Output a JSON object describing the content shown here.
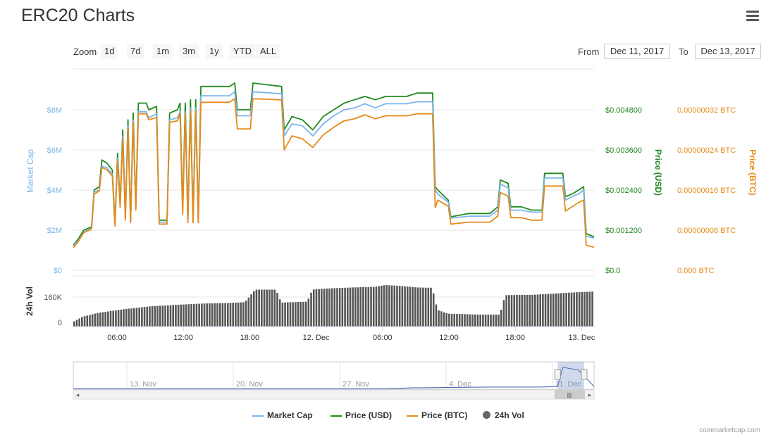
{
  "header": {
    "title": "ERC20 Charts",
    "menu_icon": "hamburger-menu-icon"
  },
  "toolbar": {
    "zoom_label": "Zoom",
    "zoom_buttons": [
      "1d",
      "7d",
      "1m",
      "3m",
      "1y",
      "YTD",
      "ALL"
    ],
    "from_label": "From",
    "from_value": "Dec 11, 2017",
    "to_label": "To",
    "to_value": "Dec 13, 2017"
  },
  "colors": {
    "market_cap": "#7cb5ec",
    "price_usd": "#1e8a1e",
    "price_btc": "#e68a1a",
    "volume": "#555555",
    "grid": "#e6e6e6"
  },
  "legend": [
    {
      "label": "Market Cap"
    },
    {
      "label": "Price (USD)"
    },
    {
      "label": "Price (BTC)"
    },
    {
      "label": "24h Vol"
    }
  ],
  "credit": "coinmarketcap.com",
  "chart_data": {
    "type": "line",
    "title": "ERC20 Charts",
    "x_range": [
      "Dec 11, 2017 02:00",
      "Dec 13, 2017 00:00"
    ],
    "x_ticks": [
      "06:00",
      "12:00",
      "18:00",
      "12. Dec",
      "06:00",
      "12:00",
      "18:00",
      "13. Dec"
    ],
    "y_axes": {
      "market_cap": {
        "label": "Market Cap",
        "ticks": [
          "$0",
          "$2M",
          "$4M",
          "$6M",
          "$8M"
        ],
        "range": [
          0,
          8000000
        ]
      },
      "price_usd": {
        "label": "Price (USD)",
        "ticks": [
          "$0.0",
          "$0.001200",
          "$0.002400",
          "$0.003600",
          "$0.004800"
        ],
        "range": [
          0,
          0.0048
        ]
      },
      "price_btc": {
        "label": "Price (BTC)",
        "ticks": [
          "0.000 BTC",
          "0.00000008 BTC",
          "0.00000016 BTC",
          "0.00000024 BTC",
          "0.00000032 BTC"
        ],
        "range": [
          0,
          3.2e-07
        ]
      },
      "volume": {
        "label": "24h Vol",
        "ticks": [
          "0",
          "160K"
        ],
        "range": [
          0,
          160000
        ]
      }
    },
    "grid": true,
    "legend_position": "bottom-center",
    "series": [
      {
        "name": "Price (USD)",
        "axis": "price_usd",
        "points": [
          [
            0.0,
            0.00075
          ],
          [
            0.01,
            0.00095
          ],
          [
            0.02,
            0.0012
          ],
          [
            0.035,
            0.0013
          ],
          [
            0.04,
            0.0024
          ],
          [
            0.05,
            0.0025
          ],
          [
            0.055,
            0.0033
          ],
          [
            0.065,
            0.0032
          ],
          [
            0.075,
            0.003
          ],
          [
            0.08,
            0.0014
          ],
          [
            0.085,
            0.0035
          ],
          [
            0.09,
            0.002
          ],
          [
            0.095,
            0.0042
          ],
          [
            0.1,
            0.0016
          ],
          [
            0.105,
            0.0045
          ],
          [
            0.11,
            0.0015
          ],
          [
            0.115,
            0.0047
          ],
          [
            0.12,
            0.0019
          ],
          [
            0.125,
            0.005
          ],
          [
            0.14,
            0.005
          ],
          [
            0.145,
            0.0048
          ],
          [
            0.16,
            0.0049
          ],
          [
            0.165,
            0.0015
          ],
          [
            0.18,
            0.0015
          ],
          [
            0.185,
            0.0047
          ],
          [
            0.2,
            0.0048
          ],
          [
            0.205,
            0.005
          ],
          [
            0.21,
            0.0018
          ],
          [
            0.215,
            0.005
          ],
          [
            0.22,
            0.0015
          ],
          [
            0.225,
            0.0051
          ],
          [
            0.23,
            0.0015
          ],
          [
            0.235,
            0.0051
          ],
          [
            0.24,
            0.0015
          ],
          [
            0.245,
            0.0055
          ],
          [
            0.3,
            0.0055
          ],
          [
            0.31,
            0.0056
          ],
          [
            0.315,
            0.0048
          ],
          [
            0.34,
            0.0048
          ],
          [
            0.345,
            0.0056
          ],
          [
            0.4,
            0.0055
          ],
          [
            0.405,
            0.0042
          ],
          [
            0.42,
            0.0046
          ],
          [
            0.44,
            0.0045
          ],
          [
            0.46,
            0.0042
          ],
          [
            0.48,
            0.0046
          ],
          [
            0.5,
            0.0048
          ],
          [
            0.52,
            0.005
          ],
          [
            0.54,
            0.0051
          ],
          [
            0.56,
            0.0052
          ],
          [
            0.58,
            0.0051
          ],
          [
            0.6,
            0.0052
          ],
          [
            0.62,
            0.0052
          ],
          [
            0.64,
            0.0052
          ],
          [
            0.66,
            0.0053
          ],
          [
            0.68,
            0.0053
          ],
          [
            0.69,
            0.0053
          ],
          [
            0.695,
            0.0025
          ],
          [
            0.7,
            0.0024
          ],
          [
            0.72,
            0.0021
          ],
          [
            0.725,
            0.0016
          ],
          [
            0.76,
            0.0017
          ],
          [
            0.8,
            0.0017
          ],
          [
            0.815,
            0.0019
          ],
          [
            0.82,
            0.0027
          ],
          [
            0.835,
            0.0026
          ],
          [
            0.84,
            0.0019
          ],
          [
            0.86,
            0.0019
          ],
          [
            0.88,
            0.0018
          ],
          [
            0.9,
            0.0018
          ],
          [
            0.905,
            0.0029
          ],
          [
            0.94,
            0.0029
          ],
          [
            0.945,
            0.0022
          ],
          [
            0.96,
            0.0023
          ],
          [
            0.97,
            0.0024
          ],
          [
            0.98,
            0.0025
          ],
          [
            0.985,
            0.0011
          ],
          [
            1.0,
            0.001
          ]
        ]
      },
      {
        "name": "Market Cap",
        "axis": "market_cap",
        "points": [
          [
            0.0,
            1200000
          ],
          [
            0.01,
            1500000
          ],
          [
            0.02,
            1900000
          ],
          [
            0.035,
            2100000
          ],
          [
            0.04,
            3900000
          ],
          [
            0.05,
            4000000
          ],
          [
            0.055,
            5200000
          ],
          [
            0.065,
            5100000
          ],
          [
            0.075,
            4800000
          ],
          [
            0.08,
            2300000
          ],
          [
            0.085,
            5600000
          ],
          [
            0.09,
            3200000
          ],
          [
            0.095,
            6700000
          ],
          [
            0.1,
            2600000
          ],
          [
            0.105,
            7200000
          ],
          [
            0.11,
            2400000
          ],
          [
            0.115,
            7500000
          ],
          [
            0.12,
            3100000
          ],
          [
            0.125,
            7900000
          ],
          [
            0.14,
            7900000
          ],
          [
            0.145,
            7600000
          ],
          [
            0.16,
            7800000
          ],
          [
            0.165,
            2400000
          ],
          [
            0.18,
            2400000
          ],
          [
            0.185,
            7500000
          ],
          [
            0.2,
            7600000
          ],
          [
            0.205,
            7900000
          ],
          [
            0.21,
            2900000
          ],
          [
            0.215,
            7900000
          ],
          [
            0.22,
            2400000
          ],
          [
            0.225,
            8100000
          ],
          [
            0.23,
            2400000
          ],
          [
            0.235,
            8100000
          ],
          [
            0.24,
            2400000
          ],
          [
            0.245,
            8700000
          ],
          [
            0.3,
            8700000
          ],
          [
            0.31,
            8900000
          ],
          [
            0.315,
            7700000
          ],
          [
            0.34,
            7700000
          ],
          [
            0.345,
            8900000
          ],
          [
            0.4,
            8800000
          ],
          [
            0.405,
            6700000
          ],
          [
            0.42,
            7300000
          ],
          [
            0.44,
            7200000
          ],
          [
            0.46,
            6700000
          ],
          [
            0.48,
            7300000
          ],
          [
            0.5,
            7700000
          ],
          [
            0.52,
            8000000
          ],
          [
            0.54,
            8100000
          ],
          [
            0.56,
            8300000
          ],
          [
            0.58,
            8100000
          ],
          [
            0.6,
            8300000
          ],
          [
            0.62,
            8300000
          ],
          [
            0.64,
            8300000
          ],
          [
            0.66,
            8400000
          ],
          [
            0.68,
            8400000
          ],
          [
            0.69,
            8400000
          ],
          [
            0.695,
            4000000
          ],
          [
            0.7,
            3800000
          ],
          [
            0.72,
            3400000
          ],
          [
            0.725,
            2600000
          ],
          [
            0.76,
            2700000
          ],
          [
            0.8,
            2700000
          ],
          [
            0.815,
            3000000
          ],
          [
            0.82,
            4300000
          ],
          [
            0.835,
            4100000
          ],
          [
            0.84,
            3000000
          ],
          [
            0.86,
            3000000
          ],
          [
            0.88,
            2900000
          ],
          [
            0.9,
            2900000
          ],
          [
            0.905,
            4600000
          ],
          [
            0.94,
            4600000
          ],
          [
            0.945,
            3500000
          ],
          [
            0.96,
            3700000
          ],
          [
            0.97,
            3800000
          ],
          [
            0.98,
            4000000
          ],
          [
            0.985,
            1700000
          ],
          [
            1.0,
            1600000
          ]
        ]
      },
      {
        "name": "Price (BTC)",
        "axis": "price_btc",
        "points": [
          [
            0.0,
            4.5e-08
          ],
          [
            0.01,
            5.8e-08
          ],
          [
            0.02,
            7.5e-08
          ],
          [
            0.035,
            8.2e-08
          ],
          [
            0.04,
            1.52e-07
          ],
          [
            0.05,
            1.58e-07
          ],
          [
            0.055,
            2.05e-07
          ],
          [
            0.065,
            2e-07
          ],
          [
            0.075,
            1.88e-07
          ],
          [
            0.08,
            8.8e-08
          ],
          [
            0.085,
            2.2e-07
          ],
          [
            0.09,
            1.25e-07
          ],
          [
            0.095,
            2.62e-07
          ],
          [
            0.1,
            1e-07
          ],
          [
            0.105,
            2.82e-07
          ],
          [
            0.11,
            9.5e-08
          ],
          [
            0.115,
            2.95e-07
          ],
          [
            0.12,
            1.2e-07
          ],
          [
            0.125,
            3.12e-07
          ],
          [
            0.14,
            3.12e-07
          ],
          [
            0.145,
            3e-07
          ],
          [
            0.16,
            3.05e-07
          ],
          [
            0.165,
            9.2e-08
          ],
          [
            0.18,
            9.2e-08
          ],
          [
            0.185,
            2.95e-07
          ],
          [
            0.2,
            2.98e-07
          ],
          [
            0.205,
            3.12e-07
          ],
          [
            0.21,
            1.12e-07
          ],
          [
            0.215,
            3.12e-07
          ],
          [
            0.22,
            9.5e-08
          ],
          [
            0.225,
            3.18e-07
          ],
          [
            0.23,
            9.5e-08
          ],
          [
            0.235,
            3.18e-07
          ],
          [
            0.24,
            9.5e-08
          ],
          [
            0.245,
            3.35e-07
          ],
          [
            0.3,
            3.35e-07
          ],
          [
            0.31,
            3.42e-07
          ],
          [
            0.315,
            2.82e-07
          ],
          [
            0.34,
            2.82e-07
          ],
          [
            0.345,
            3.42e-07
          ],
          [
            0.4,
            3.4e-07
          ],
          [
            0.405,
            2.4e-07
          ],
          [
            0.42,
            2.68e-07
          ],
          [
            0.44,
            2.62e-07
          ],
          [
            0.46,
            2.45e-07
          ],
          [
            0.48,
            2.7e-07
          ],
          [
            0.5,
            2.85e-07
          ],
          [
            0.52,
            2.98e-07
          ],
          [
            0.54,
            3.02e-07
          ],
          [
            0.56,
            3.1e-07
          ],
          [
            0.58,
            3.02e-07
          ],
          [
            0.6,
            3.08e-07
          ],
          [
            0.62,
            3.08e-07
          ],
          [
            0.64,
            3.08e-07
          ],
          [
            0.66,
            3.12e-07
          ],
          [
            0.68,
            3.12e-07
          ],
          [
            0.69,
            3.12e-07
          ],
          [
            0.695,
            1.25e-07
          ],
          [
            0.7,
            1.4e-07
          ],
          [
            0.72,
            1.28e-07
          ],
          [
            0.725,
            9.2e-08
          ],
          [
            0.76,
            9.6e-08
          ],
          [
            0.8,
            9.6e-08
          ],
          [
            0.815,
            1.08e-07
          ],
          [
            0.82,
            1.55e-07
          ],
          [
            0.835,
            1.48e-07
          ],
          [
            0.84,
            1.05e-07
          ],
          [
            0.86,
            1.05e-07
          ],
          [
            0.88,
            1e-07
          ],
          [
            0.9,
            1e-07
          ],
          [
            0.905,
            1.68e-07
          ],
          [
            0.94,
            1.68e-07
          ],
          [
            0.945,
            1.18e-07
          ],
          [
            0.96,
            1.28e-07
          ],
          [
            0.97,
            1.35e-07
          ],
          [
            0.98,
            1.4e-07
          ],
          [
            0.985,
            5e-08
          ],
          [
            1.0,
            4.6e-08
          ]
        ]
      }
    ],
    "volume_series": {
      "name": "24h Vol",
      "axis": "volume",
      "points": [
        [
          0.0,
          25000
        ],
        [
          0.02,
          55000
        ],
        [
          0.05,
          75000
        ],
        [
          0.1,
          95000
        ],
        [
          0.15,
          110000
        ],
        [
          0.2,
          118000
        ],
        [
          0.25,
          125000
        ],
        [
          0.3,
          128000
        ],
        [
          0.33,
          132000
        ],
        [
          0.35,
          200000
        ],
        [
          0.39,
          200000
        ],
        [
          0.4,
          130000
        ],
        [
          0.45,
          135000
        ],
        [
          0.46,
          200000
        ],
        [
          0.48,
          205000
        ],
        [
          0.52,
          210000
        ],
        [
          0.55,
          213000
        ],
        [
          0.58,
          215000
        ],
        [
          0.6,
          225000
        ],
        [
          0.63,
          220000
        ],
        [
          0.66,
          212000
        ],
        [
          0.69,
          210000
        ],
        [
          0.7,
          90000
        ],
        [
          0.72,
          70000
        ],
        [
          0.78,
          65000
        ],
        [
          0.82,
          65000
        ],
        [
          0.83,
          170000
        ],
        [
          0.88,
          172000
        ],
        [
          0.92,
          178000
        ],
        [
          0.96,
          185000
        ],
        [
          1.0,
          190000
        ]
      ]
    },
    "navigator": {
      "labels": [
        "13. Nov",
        "20. Nov",
        "27. Nov",
        "4. Dec",
        "11. Dec"
      ],
      "points": [
        [
          0.0,
          0.02
        ],
        [
          0.6,
          0.02
        ],
        [
          0.65,
          0.05
        ],
        [
          0.7,
          0.06
        ],
        [
          0.75,
          0.07
        ],
        [
          0.8,
          0.08
        ],
        [
          0.9,
          0.08
        ],
        [
          0.93,
          0.1
        ],
        [
          0.94,
          0.8
        ],
        [
          0.97,
          0.7
        ],
        [
          1.0,
          0.1
        ]
      ]
    }
  }
}
